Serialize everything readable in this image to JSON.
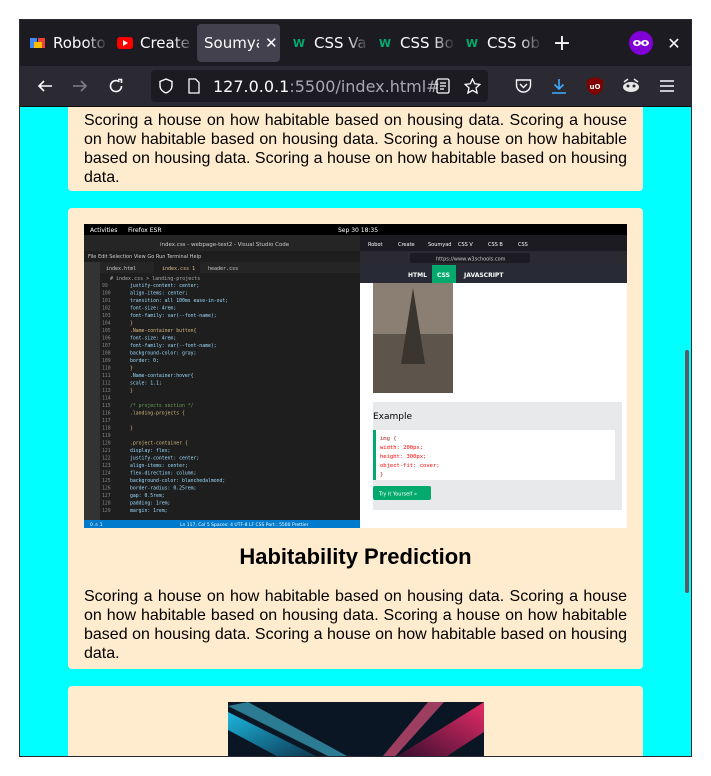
{
  "browser": {
    "tabs": [
      {
        "label": "Roboto",
        "favicon": "roboto-favicon",
        "active": false
      },
      {
        "label": "Create",
        "favicon": "youtube-favicon",
        "active": false
      },
      {
        "label": "Soumya",
        "favicon": "",
        "active": true
      },
      {
        "label": "CSS Va",
        "favicon": "w3schools-favicon",
        "active": false
      },
      {
        "label": "CSS Bo",
        "favicon": "w3schools-favicon",
        "active": false
      },
      {
        "label": "CSS ob",
        "favicon": "w3schools-favicon",
        "active": false
      }
    ],
    "url_host": "127.0.0.1",
    "url_rest": ":5500/index.html#",
    "colors": {
      "tabbar": "#1c1b22",
      "toolbar": "#2b2a33",
      "page_bg": "#00ffff",
      "card_bg": "#ffebcd"
    }
  },
  "page": {
    "card1": {
      "text": "Scoring a house on how habitable based on housing data. Scoring a house on how habitable based on housing data. Scoring a house on how habitable based on housing data. Scoring a house on how habitable based on housing data."
    },
    "card2": {
      "title": "Habitability Prediction",
      "text": "Scoring a house on how habitable based on housing data. Scoring a house on how habitable based on housing data. Scoring a house on how habitable based on housing data. Scoring a house on how habitable based on housing data.",
      "screenshot": {
        "os_bar_left": "Activities",
        "os_bar_app": "Firefox ESR",
        "os_bar_time": "Sep 30 18:35",
        "editor_title": "index.css - webpage-test2 - Visual Studio Code",
        "editor_menu": "File  Edit  Selection  View  Go  Run  Terminal  Help",
        "editor_tabs": [
          "index.html",
          "index.css 1",
          "header.css"
        ],
        "editor_breadcrumb": "# index.css > landing-projects",
        "code_lines": [
          {
            "n": "99",
            "t": "    justify-content: center;"
          },
          {
            "n": "100",
            "t": "    align-items: center;"
          },
          {
            "n": "101",
            "t": "    transition: all 100ms ease-in-out;"
          },
          {
            "n": "102",
            "t": "    font-size: 4rem;"
          },
          {
            "n": "103",
            "t": "    font-family: var(--font-name);"
          },
          {
            "n": "104",
            "t": "}"
          },
          {
            "n": "105",
            "t": ".Name-container button{"
          },
          {
            "n": "106",
            "t": "    font-size: 4rem;"
          },
          {
            "n": "107",
            "t": "    font-family: var(--font-name);"
          },
          {
            "n": "108",
            "t": "    background-color: gray;"
          },
          {
            "n": "109",
            "t": "    border: 0;"
          },
          {
            "n": "110",
            "t": "}"
          },
          {
            "n": "111",
            "t": ".Name-container:hover{"
          },
          {
            "n": "112",
            "t": "    scale: 1.1;"
          },
          {
            "n": "113",
            "t": "}"
          },
          {
            "n": "114",
            "t": ""
          },
          {
            "n": "115",
            "t": "/* projects section */"
          },
          {
            "n": "116",
            "t": ".landing-projects {"
          },
          {
            "n": "117",
            "t": ""
          },
          {
            "n": "118",
            "t": "}"
          },
          {
            "n": "119",
            "t": ""
          },
          {
            "n": "120",
            "t": ".project-container {"
          },
          {
            "n": "121",
            "t": "    display: flex;"
          },
          {
            "n": "122",
            "t": "    justify-content: center;"
          },
          {
            "n": "123",
            "t": "    align-items: center;"
          },
          {
            "n": "124",
            "t": "    flex-direction: column;"
          },
          {
            "n": "125",
            "t": "    background-color: blanchedalmond;"
          },
          {
            "n": "126",
            "t": "    border-radius: 0.25rem;"
          },
          {
            "n": "127",
            "t": "    gap: 0.5rem;"
          },
          {
            "n": "128",
            "t": "    padding: 1rem;"
          },
          {
            "n": "129",
            "t": "    margin: 1rem;"
          }
        ],
        "status_bar": "Ln 117, Col 5   Spaces: 4   UTF-8   LF   CSS   Port : 5500   Prettier",
        "status_left": "0 ⚠ 1",
        "inner_tabs": [
          "Robot",
          "Create",
          "Soumyad",
          "CSS V",
          "CSS B",
          "CSS"
        ],
        "inner_url": "https://www.w3schools.com",
        "w3_nav": [
          "HTML",
          "CSS",
          "JAVASCRIPT"
        ],
        "example_title": "Example",
        "example_code": [
          "img {",
          "  width: 200px;",
          "  height: 300px;",
          "  object-fit: cover;",
          "}"
        ],
        "try_button": "Try it Yourself »"
      }
    }
  }
}
